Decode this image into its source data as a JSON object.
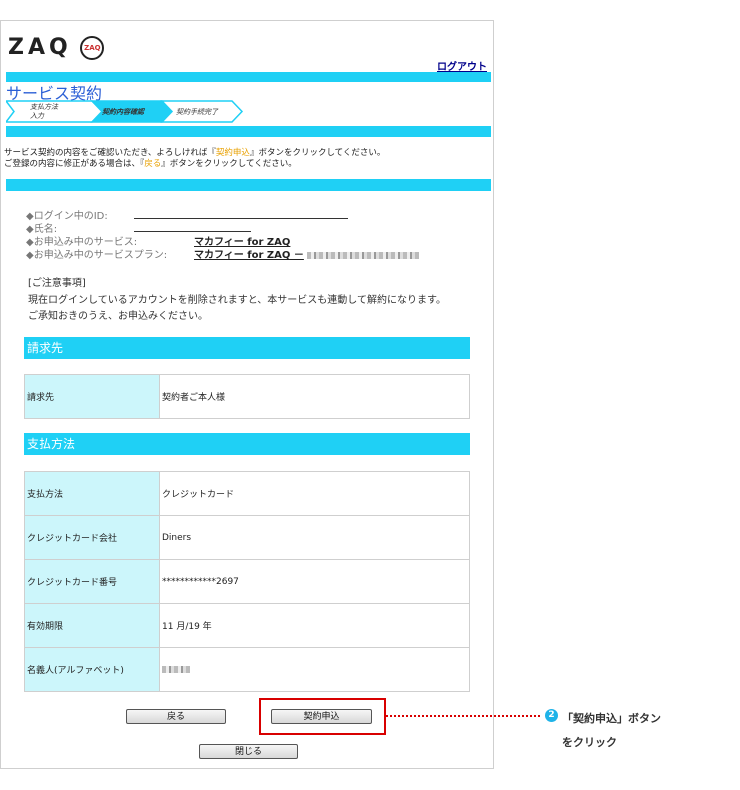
{
  "header": {
    "logo_text": "ZAQ",
    "logo_badge": "ZAQ",
    "logout_label": "ログアウト"
  },
  "service": {
    "title": "サービス契約",
    "steps": [
      {
        "label_line1": "支払方法",
        "label_line2": "入力"
      },
      {
        "label_line1": "契約内容確認",
        "label_line2": ""
      },
      {
        "label_line1": "契約手続完了",
        "label_line2": ""
      }
    ]
  },
  "instructions": {
    "line1_pre": "サービス契約の内容をご確認いただき、よろしければ『",
    "line1_hl": "契約申込",
    "line1_post": "』ボタンをクリックしてください。",
    "line2_pre": "ご登録の内容に修正がある場合は、『",
    "line2_hl": "戻る",
    "line2_post": "』ボタンをクリックしてください。"
  },
  "info": {
    "login_id_label": "◆ログイン中のID:",
    "name_label": "◆氏名:",
    "service_label": "◆お申込み中のサービス:",
    "service_value": "マカフィー for ZAQ",
    "plan_label": "◆お申込み中のサービスプラン:",
    "plan_value": "マカフィー for ZAQ －"
  },
  "notice": {
    "title": "[ご注意事項]",
    "line1": "現在ログインしているアカウントを削除されますと、本サービスも連動して解約になります。",
    "line2": "ご承知おきのうえ、お申込みください。"
  },
  "billing": {
    "heading": "請求先",
    "rows": [
      {
        "label": "請求先",
        "value": "契約者ご本人様"
      }
    ]
  },
  "payment": {
    "heading": "支払方法",
    "rows": [
      {
        "label": "支払方法",
        "value": "クレジットカード"
      },
      {
        "label": "クレジットカード会社",
        "value": "Diners"
      },
      {
        "label": "クレジットカード番号",
        "value": "************2697"
      },
      {
        "label": "有効期限",
        "value": "11 月/19 年"
      },
      {
        "label": "名義人(アルファベット)",
        "value": ""
      }
    ]
  },
  "buttons": {
    "back": "戻る",
    "apply": "契約申込",
    "close": "閉じる"
  },
  "callout": {
    "number": "2",
    "line1": "「契約申込」ボタン",
    "line2": "をクリック"
  },
  "colors": {
    "accent": "#1fd0f5",
    "table_header_bg": "#ccf6fb",
    "highlight": "#e8a000",
    "callout_red": "#d80000",
    "callout_badge": "#1fb3e8"
  }
}
